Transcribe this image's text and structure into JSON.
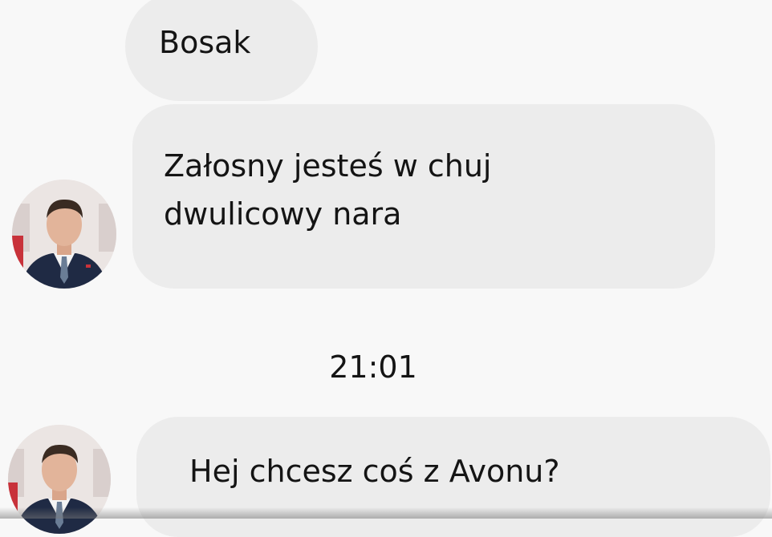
{
  "chat": {
    "messages": [
      {
        "text": "Bosak"
      },
      {
        "line1": "Załosny jesteś w chuj",
        "line2": "dwulicowy nara"
      },
      {
        "text": "Hej chcesz coś z Avonu?"
      }
    ],
    "timestamp": "21:01"
  },
  "colors": {
    "background": "#f8f8f8",
    "bubble": "#ececec",
    "text": "#141414"
  },
  "icons": {
    "avatar": "user-avatar-photo"
  }
}
